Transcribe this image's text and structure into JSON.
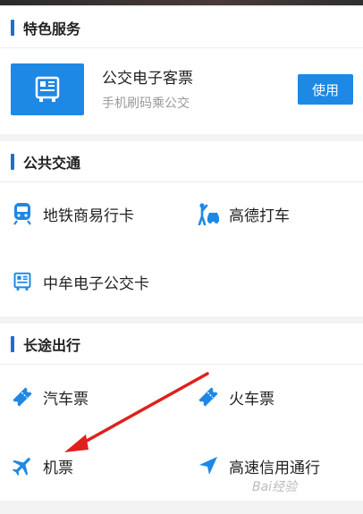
{
  "sections": {
    "special": {
      "title": "特色服务",
      "featured": {
        "title": "公交电子客票",
        "subtitle": "手机刷码乘公交",
        "button": "使用",
        "icon": "bus-qr-icon"
      }
    },
    "public": {
      "title": "公共交通",
      "items": [
        {
          "label": "地铁商易行卡",
          "icon": "subway-icon"
        },
        {
          "label": "高德打车",
          "icon": "taxi-hail-icon"
        },
        {
          "label": "中牟电子公交卡",
          "icon": "bus-qr-icon"
        }
      ]
    },
    "long": {
      "title": "长途出行",
      "items": [
        {
          "label": "汽车票",
          "icon": "ticket-icon"
        },
        {
          "label": "火车票",
          "icon": "ticket-icon"
        },
        {
          "label": "机票",
          "icon": "airplane-icon"
        },
        {
          "label": "高速信用通行",
          "icon": "navigation-arrow-icon"
        }
      ]
    }
  },
  "watermark": "Bai经验",
  "colors": {
    "accent": "#1e88e5",
    "annotation": "#e0201b"
  }
}
